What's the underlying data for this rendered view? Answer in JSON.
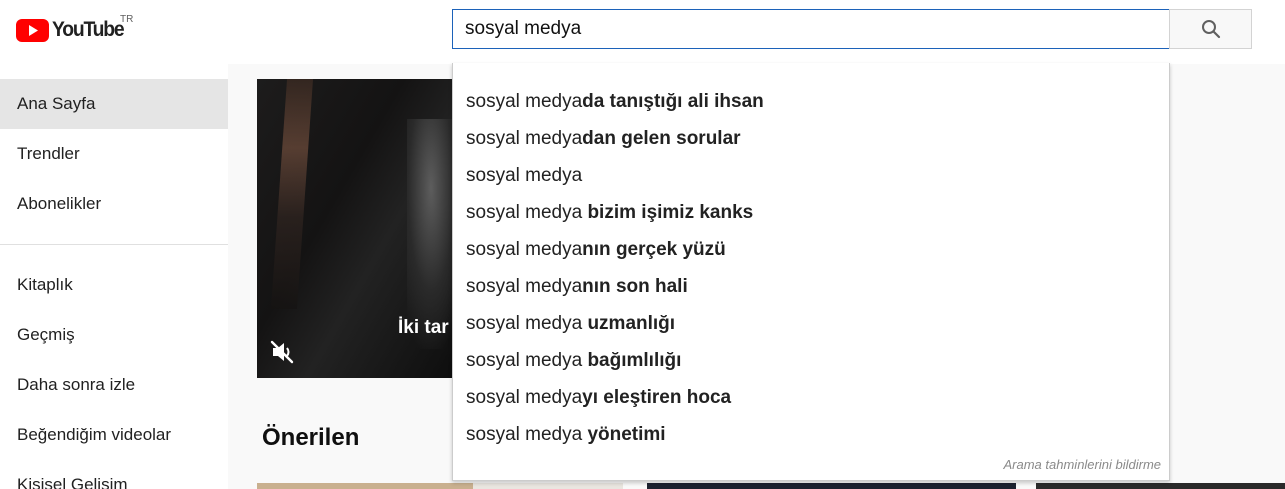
{
  "brand": {
    "name": "YouTube",
    "region": "TR",
    "accent": "#ff0000"
  },
  "search": {
    "value": "sosyal medya",
    "button_icon": "search-icon"
  },
  "sidebar": {
    "items": [
      {
        "label": "Ana Sayfa",
        "active": true
      },
      {
        "label": "Trendler"
      },
      {
        "label": "Abonelikler"
      },
      {
        "label": "Kitaplık"
      },
      {
        "label": "Geçmiş"
      },
      {
        "label": "Daha sonra izle"
      },
      {
        "label": "Beğendiğim videolar"
      },
      {
        "label": "Kişisel Gelişim"
      }
    ]
  },
  "player": {
    "caption": "İki tar",
    "mute_icon": "muted-speaker-icon"
  },
  "main": {
    "section_title": "Önerilen"
  },
  "suggestions": {
    "items": [
      {
        "base": "sosyal medya",
        "rest": "da tanıştığı ali ihsan"
      },
      {
        "base": "sosyal medya",
        "rest": "dan gelen sorular"
      },
      {
        "base": "sosyal medya",
        "rest": ""
      },
      {
        "base": "sosyal medya ",
        "rest": "bizim işimiz kanks"
      },
      {
        "base": "sosyal medya",
        "rest": "nın gerçek yüzü"
      },
      {
        "base": "sosyal medya",
        "rest": "nın son hali"
      },
      {
        "base": "sosyal medya ",
        "rest": "uzmanlığı"
      },
      {
        "base": "sosyal medya ",
        "rest": "bağımlılığı"
      },
      {
        "base": "sosyal medya",
        "rest": "yı eleştiren hoca"
      },
      {
        "base": "sosyal medya ",
        "rest": "yönetimi"
      }
    ],
    "footer": "Arama tahminlerini bildirme"
  }
}
